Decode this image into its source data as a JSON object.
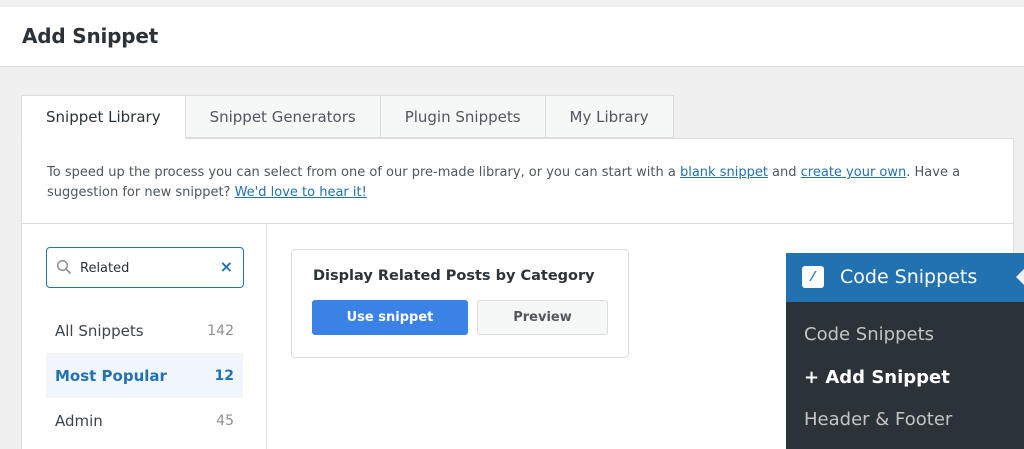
{
  "header": {
    "title": "Add Snippet"
  },
  "tabs": [
    {
      "label": "Snippet Library",
      "active": true
    },
    {
      "label": "Snippet Generators",
      "active": false
    },
    {
      "label": "Plugin Snippets",
      "active": false
    },
    {
      "label": "My Library",
      "active": false
    }
  ],
  "intro": {
    "text_1": "To speed up the process you can select from one of our pre-made library, or you can start with a ",
    "link_1": "blank snippet",
    "text_2": " and ",
    "link_2": "create your own",
    "text_3": ". Have a suggestion for new snippet? ",
    "link_3": "We'd love to hear it!"
  },
  "search": {
    "value": "Related",
    "clear_icon": "×"
  },
  "categories": [
    {
      "label": "All Snippets",
      "count": "142"
    },
    {
      "label": "Most Popular",
      "count": "12"
    },
    {
      "label": "Admin",
      "count": "45"
    }
  ],
  "card": {
    "title": "Display Related Posts by Category",
    "use_label": "Use snippet",
    "preview_label": "Preview"
  },
  "wp_menu": {
    "title": "Code Snippets",
    "items": [
      "Code Snippets",
      "+ Add Snippet",
      "Header & Footer"
    ]
  },
  "colors": {
    "accent": "#2271b1",
    "primary_button": "#3b82e6",
    "menu_bg": "#2c3338"
  }
}
